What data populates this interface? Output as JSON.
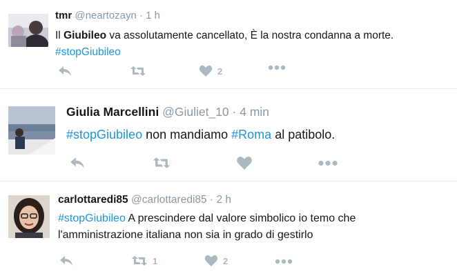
{
  "tweets": [
    {
      "name": "tmr",
      "handle": "@neartozayn",
      "sep": "·",
      "time": "1 h",
      "text_pre": "Il ",
      "text_bold": "Giubileo",
      "text_post": " va assolutamente cancellato, È la nostra condanna a morte.",
      "hashtag": "#stopGiubileo",
      "likes": "2"
    },
    {
      "name": "Giulia Marcellini",
      "handle": "@Giuliet_10",
      "sep": "·",
      "time": "4 min",
      "hashtag1": "#stopGiubileo",
      "text_mid": " non mandiamo ",
      "hashtag2": "#Roma",
      "text_end": " al patibolo."
    },
    {
      "name": "carlottaredi85",
      "handle": "@carlottaredi85",
      "sep": "·",
      "time": "2 h",
      "hashtag": "#stopGiubileo",
      "line1_rest": " A prescindere dal valore simbolico io temo che",
      "line2": "l'amministrazione italiana non sia in grado di gestirlo",
      "retweets": "1",
      "likes": "2"
    }
  ],
  "colors": {
    "hashtag": "#1b95e0",
    "icon": "#aab8c2",
    "meta": "#8899a6"
  },
  "icons": [
    "reply-icon",
    "retweet-icon",
    "like-icon",
    "more-icon"
  ]
}
